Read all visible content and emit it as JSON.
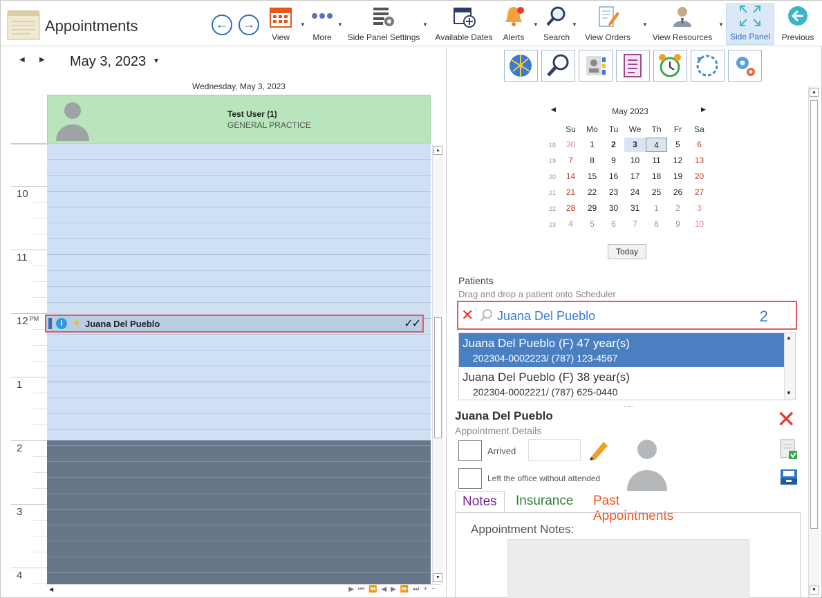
{
  "toolbar": {
    "title": "Appointments",
    "buttons": [
      {
        "label": "View",
        "icon": "calendar-icon"
      },
      {
        "label": "More",
        "icon": "more-dots-icon"
      },
      {
        "label": "Side Panel Settings",
        "icon": "panel-settings-icon"
      },
      {
        "label": "Available Dates",
        "icon": "calendar-add-icon"
      },
      {
        "label": "Alerts",
        "icon": "bell-icon"
      },
      {
        "label": "Search",
        "icon": "search-icon"
      },
      {
        "label": "View Orders",
        "icon": "orders-icon"
      },
      {
        "label": "View Resources",
        "icon": "resources-icon"
      },
      {
        "label": "Side Panel",
        "icon": "expand-icon",
        "active": true
      },
      {
        "label": "Previous",
        "icon": "back-circle-icon"
      }
    ]
  },
  "scheduler": {
    "date_title": "May 3, 2023",
    "day_header": "Wednesday, May 3, 2023",
    "resource": {
      "name": "Test User (1)",
      "specialty": "GENERAL PRACTICE"
    },
    "hours": [
      {
        "label": "10",
        "ampm": ""
      },
      {
        "label": "11",
        "ampm": ""
      },
      {
        "label": "12",
        "ampm": "PM"
      },
      {
        "label": "1",
        "ampm": ""
      },
      {
        "label": "2",
        "ampm": ""
      },
      {
        "label": "3",
        "ampm": ""
      },
      {
        "label": "4",
        "ampm": ""
      }
    ],
    "appointment": {
      "patient": "Juana Del Pueblo",
      "info_icon": "i",
      "status": "✓✓"
    }
  },
  "side_panel": {
    "icons": [
      "globe-network-icon",
      "magnifier-icon",
      "contact-card-icon",
      "checklist-icon",
      "alarm-clock-icon",
      "refresh-icon",
      "gears-icon"
    ],
    "mini_calendar": {
      "title": "May 2023",
      "day_headers": [
        "Su",
        "Mo",
        "Tu",
        "We",
        "Th",
        "Fr",
        "Sa"
      ],
      "weeks": [
        {
          "wk": "18",
          "days": [
            "30",
            "1",
            "2",
            "3",
            "4",
            "5",
            "6"
          ]
        },
        {
          "wk": "19",
          "days": [
            "7",
            "8",
            "9",
            "10",
            "11",
            "12",
            "13"
          ]
        },
        {
          "wk": "20",
          "days": [
            "14",
            "15",
            "16",
            "17",
            "18",
            "19",
            "20"
          ]
        },
        {
          "wk": "21",
          "days": [
            "21",
            "22",
            "23",
            "24",
            "25",
            "26",
            "27"
          ]
        },
        {
          "wk": "22",
          "days": [
            "28",
            "29",
            "30",
            "31",
            "1",
            "2",
            "3"
          ]
        },
        {
          "wk": "23",
          "days": [
            "4",
            "5",
            "6",
            "7",
            "8",
            "9",
            "10"
          ]
        }
      ],
      "selected_day": "3",
      "today_day": "4",
      "today_button": "Today"
    },
    "patients": {
      "title": "Patients",
      "hint": "Drag and drop a patient onto Scheduler",
      "search_value": "Juana Del Pueblo",
      "result_count": "2",
      "results": [
        {
          "name": "Juana Del Pueblo",
          "meta": "(F) 47 year(s)",
          "line2": "202304-0002223/ (787) 123-4567",
          "selected": true
        },
        {
          "name": "Juana Del Pueblo",
          "meta": "(F) 38 year(s)",
          "line2": "202304-0002221/ (787) 625-0440",
          "selected": false
        }
      ]
    },
    "details": {
      "patient_name": "Juana Del Pueblo",
      "subtitle": "Appointment Details",
      "arrived_label": "Arrived",
      "left_label": "Left the office without attended"
    },
    "tabs": [
      {
        "label": "Notes",
        "color": "#7b1fa2"
      },
      {
        "label": "Insurance",
        "color": "#2e7d32"
      },
      {
        "label": "Past Appointments",
        "color": "#f4511e"
      }
    ],
    "notes_label": "Appointment Notes:"
  },
  "colors": {
    "accent": "#2f6fc4",
    "resource_header": "#b8e5bb",
    "working_hours": "#cfe0f4",
    "off_hours": "#677789",
    "highlight_border": "#e05c5c"
  }
}
